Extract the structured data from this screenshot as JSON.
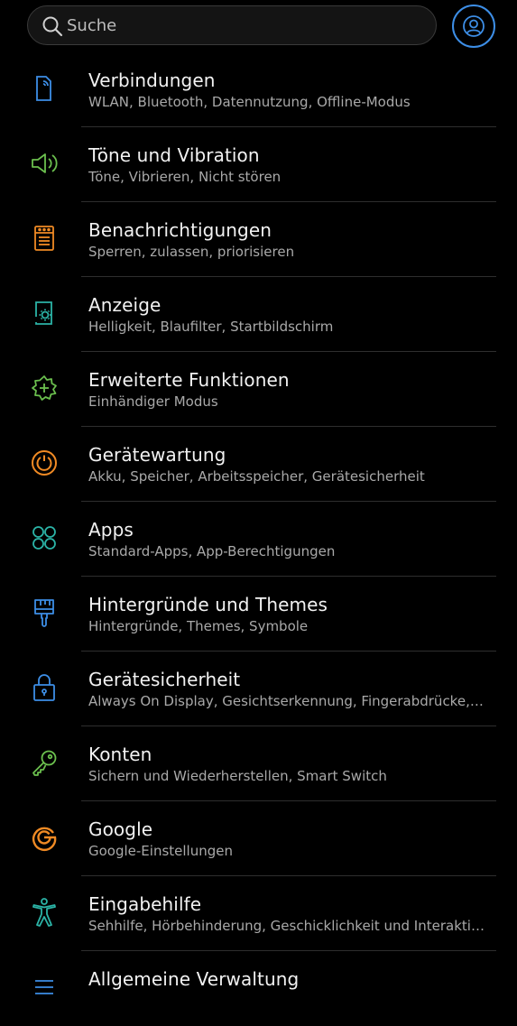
{
  "search": {
    "placeholder": "Suche"
  },
  "icons": {
    "search": "search-icon",
    "profile": "account-icon"
  },
  "colors": {
    "blue": "#3d8ee6",
    "green": "#6bbf4e",
    "orange": "#f08a24",
    "teal": "#2bb3a6"
  },
  "items": [
    {
      "title": "Verbindungen",
      "subtitle": "WLAN, Bluetooth, Datennutzung, Offline-Modus",
      "icon": "connections-icon",
      "color": "#3d8ee6"
    },
    {
      "title": "Töne und Vibration",
      "subtitle": "Töne, Vibrieren, Nicht stören",
      "icon": "sound-icon",
      "color": "#6bbf4e"
    },
    {
      "title": "Benachrichtigungen",
      "subtitle": "Sperren, zulassen, priorisieren",
      "icon": "notifications-icon",
      "color": "#f08a24"
    },
    {
      "title": "Anzeige",
      "subtitle": "Helligkeit, Blaufilter, Startbildschirm",
      "icon": "display-icon",
      "color": "#2bb3a6"
    },
    {
      "title": "Erweiterte Funktionen",
      "subtitle": "Einhändiger Modus",
      "icon": "advanced-features-icon",
      "color": "#6bbf4e"
    },
    {
      "title": "Gerätewartung",
      "subtitle": "Akku, Speicher, Arbeitsspeicher, Gerätesicherheit",
      "icon": "device-care-icon",
      "color": "#f08a24"
    },
    {
      "title": "Apps",
      "subtitle": "Standard-Apps, App-Berechtigungen",
      "icon": "apps-icon",
      "color": "#2bb3a6"
    },
    {
      "title": "Hintergründe und Themes",
      "subtitle": "Hintergründe, Themes, Symbole",
      "icon": "themes-brush-icon",
      "color": "#3d8ee6"
    },
    {
      "title": "Gerätesicherheit",
      "subtitle": "Always On Display, Gesichtserkennung, Fingerabdrücke,…",
      "icon": "lock-icon",
      "color": "#3d8ee6"
    },
    {
      "title": "Konten",
      "subtitle": "Sichern und Wiederherstellen, Smart Switch",
      "icon": "key-icon",
      "color": "#6bbf4e"
    },
    {
      "title": "Google",
      "subtitle": "Google-Einstellungen",
      "icon": "google-icon",
      "color": "#f08a24"
    },
    {
      "title": "Eingabehilfe",
      "subtitle": "Sehhilfe, Hörbehinderung, Geschicklichkeit und Interaktion",
      "icon": "accessibility-icon",
      "color": "#2bb3a6"
    },
    {
      "title": "Allgemeine Verwaltung",
      "subtitle": "",
      "icon": "general-management-icon",
      "color": "#3d8ee6"
    }
  ]
}
